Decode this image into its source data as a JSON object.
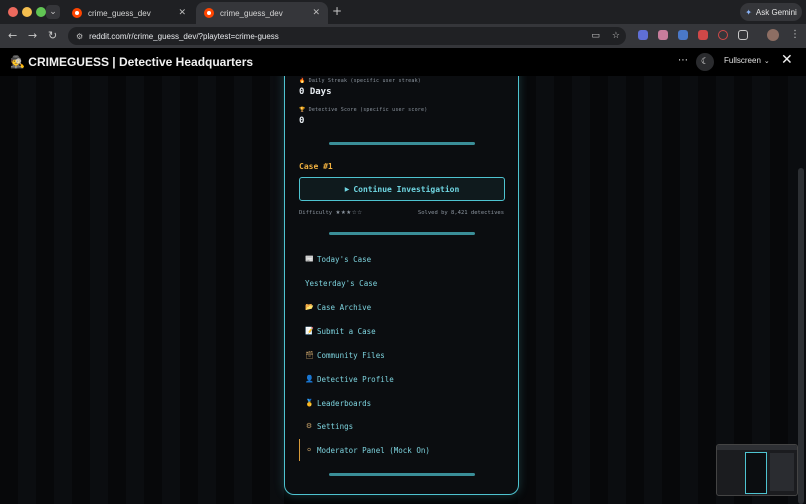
{
  "browser": {
    "tabs": [
      {
        "title": "crime_guess_dev"
      },
      {
        "title": "crime_guess_dev"
      }
    ],
    "url": "reddit.com/r/crime_guess_dev/?playtest=crime-guess",
    "ask_gemini": "Ask Gemini"
  },
  "header": {
    "title": "🕵 CRIMEGUESS | Detective Headquarters",
    "fullscreen_label": "Fullscreen"
  },
  "stats": {
    "streak_label": "🔥 Daily Streak (specific user streak)",
    "streak_value": "0 Days",
    "score_label": "🏆 Detective Score (specific user score)",
    "score_value": "0"
  },
  "case": {
    "number_label": "Case #1",
    "continue_label": "Continue Investigation",
    "difficulty_label": "Difficulty",
    "difficulty_stars": "★★★☆☆",
    "difficulty_level": 3,
    "difficulty_max": 5,
    "solved_label": "Solved by 8,421 detectives"
  },
  "menu": [
    {
      "icon": "📰",
      "icon_name": "newspaper-icon",
      "label": "Today's Case"
    },
    {
      "icon": "",
      "icon_name": "",
      "label": "Yesterday's Case"
    },
    {
      "icon": "📂",
      "icon_name": "folder-icon",
      "label": "Case Archive"
    },
    {
      "icon": "📝",
      "icon_name": "memo-icon",
      "label": "Submit a Case"
    },
    {
      "icon": "🗃",
      "icon_name": "file-box-icon",
      "label": "Community Files"
    },
    {
      "icon": "👤",
      "icon_name": "user-icon",
      "label": "Detective Profile"
    },
    {
      "icon": "🥇",
      "icon_name": "medal-icon",
      "label": "Leaderboards"
    },
    {
      "icon": "⚙",
      "icon_name": "gear-icon",
      "label": "Settings"
    },
    {
      "icon": "⚪",
      "icon_name": "moderator-icon",
      "label": "Moderator Panel (Mock On)"
    }
  ],
  "colors": {
    "accent": "#4ec3d0",
    "case_number": "#f0b040",
    "moderator_border": "#d69a3a"
  }
}
